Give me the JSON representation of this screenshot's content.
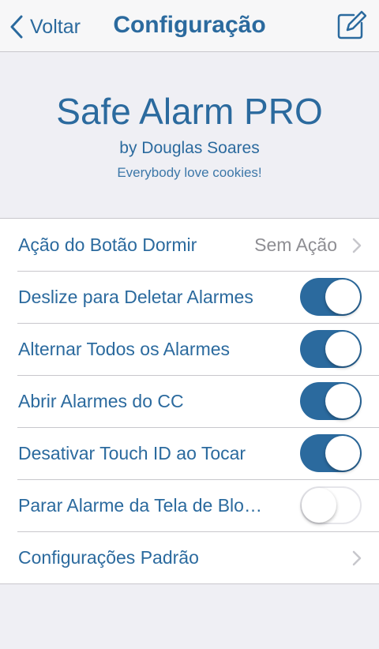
{
  "nav": {
    "back_label": "Voltar",
    "title": "Configuração",
    "compose_icon": "compose-icon"
  },
  "header": {
    "app_name": "Safe Alarm PRO",
    "author": "by Douglas Soares",
    "tagline": "Everybody love cookies!"
  },
  "settings": [
    {
      "label": "Ação do Botão Dormir",
      "value": "Sem Ação",
      "type": "disclosure"
    },
    {
      "label": "Deslize para Deletar Alarmes",
      "type": "toggle",
      "on": true
    },
    {
      "label": "Alternar Todos os Alarmes",
      "type": "toggle",
      "on": true
    },
    {
      "label": "Abrir Alarmes do CC",
      "type": "toggle",
      "on": true
    },
    {
      "label": "Desativar Touch ID ao Tocar",
      "type": "toggle",
      "on": true
    },
    {
      "label": "Parar Alarme da Tela de Blo…",
      "type": "toggle",
      "on": false
    },
    {
      "label": "Configurações Padrão",
      "type": "disclosure"
    }
  ],
  "colors": {
    "accent": "#2b6a9e",
    "background": "#efeff4",
    "secondary_text": "#8e8e93"
  }
}
